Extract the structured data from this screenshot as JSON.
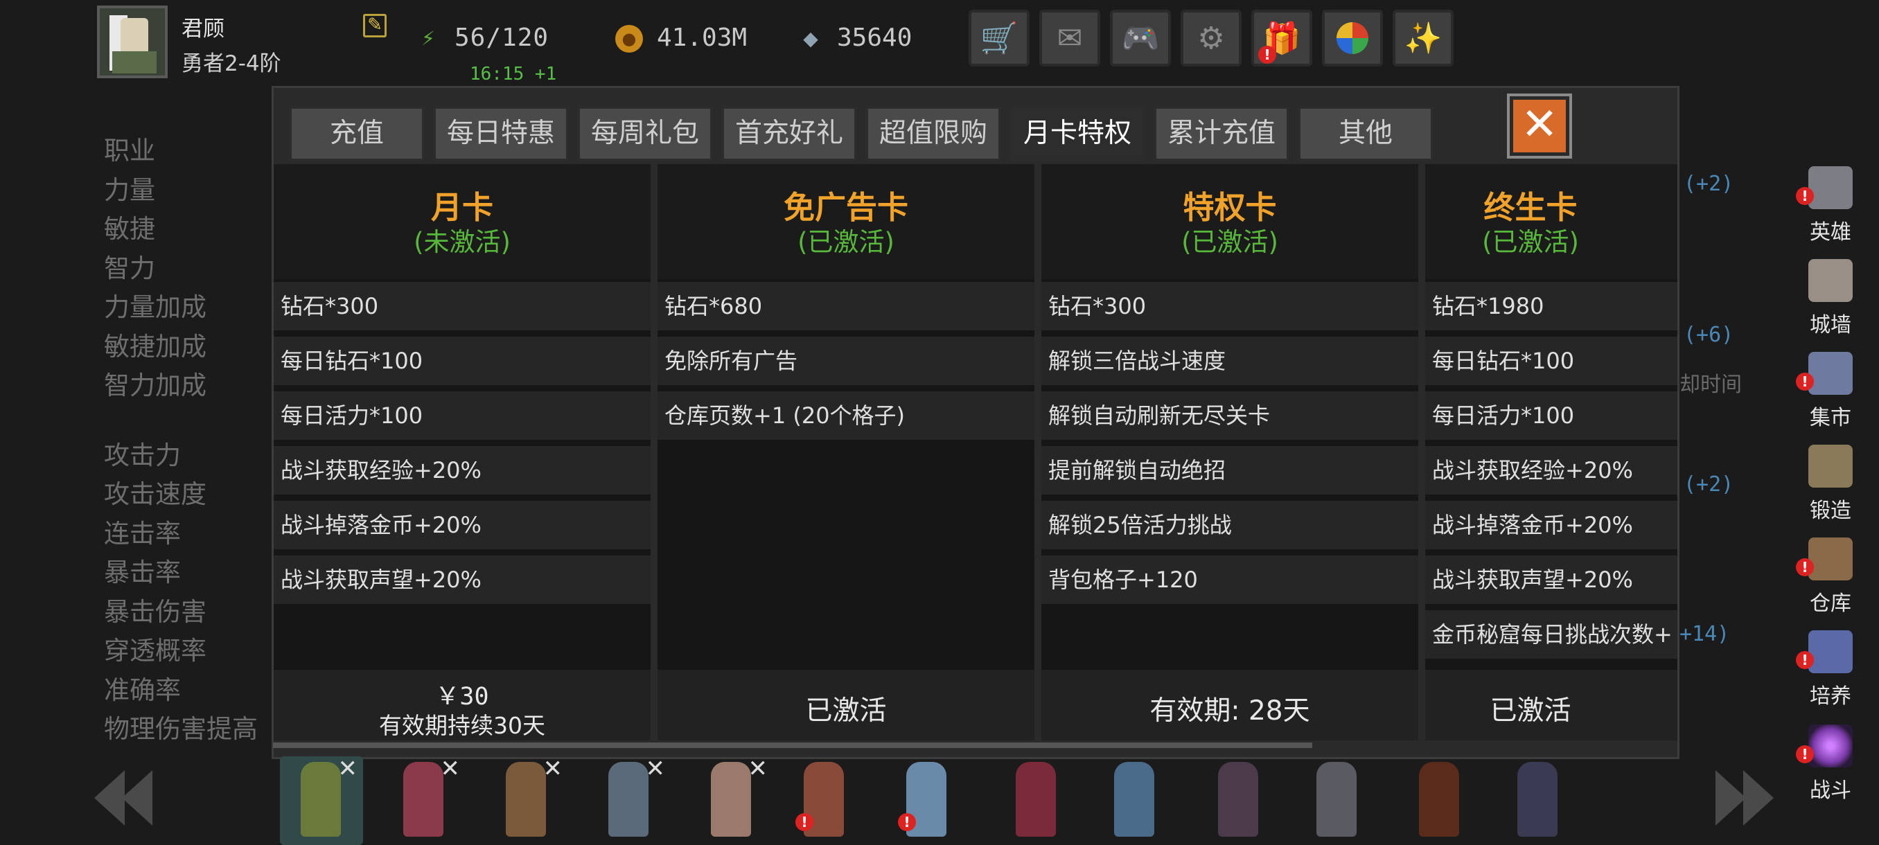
{
  "player": {
    "name": "君顾",
    "rank": "勇者2-4阶"
  },
  "resources": {
    "energy": "56/120",
    "energy_timer": "16:15 +1",
    "gold": "41.03M",
    "diamonds": "35640"
  },
  "top_buttons": [
    "shop-cart-icon",
    "mail-icon",
    "gamepad-icon",
    "settings-gear-icon",
    "gift-icon",
    "prize-wheel-icon",
    "fireworks-icon"
  ],
  "stats_left": {
    "group1": [
      "职业",
      "力量",
      "敏捷",
      "智力",
      "力量加成",
      "敏捷加成",
      "智力加成"
    ],
    "group2": [
      "攻击力",
      "攻击速度",
      "连击率",
      "暴击率",
      "暴击伤害",
      "穿透概率",
      "准确率",
      "物理伤害提高"
    ]
  },
  "bg_snippets": [
    "(+2)",
    "(+6)",
    "却时间",
    "(+2)",
    "+14)"
  ],
  "tabs": [
    "充值",
    "每日特惠",
    "每周礼包",
    "首充好礼",
    "超值限购",
    "月卡特权",
    "累计充值",
    "其他"
  ],
  "active_tab": "月卡特权",
  "cards": [
    {
      "title": "月卡",
      "status": "(未激活)",
      "rows": [
        "钻石*300",
        "每日钻石*100",
        "每日活力*100",
        "战斗获取经验+20%",
        "战斗掉落金币+20%",
        "战斗获取声望+20%"
      ],
      "price": "￥30",
      "footer_sub": "有效期持续30天"
    },
    {
      "title": "免广告卡",
      "status": "(已激活)",
      "rows": [
        "钻石*680",
        "免除所有广告",
        "仓库页数+1 (20个格子)"
      ],
      "footer": "已激活"
    },
    {
      "title": "特权卡",
      "status": "(已激活)",
      "rows": [
        "钻石*300",
        "解锁三倍战斗速度",
        "解锁自动刷新无尽关卡",
        "提前解锁自动绝招",
        "解锁25倍活力挑战",
        "背包格子+120"
      ],
      "footer": "有效期: 28天"
    },
    {
      "title": "终生卡",
      "status": "(已激活)",
      "rows": [
        "钻石*1980",
        "每日钻石*100",
        "每日活力*100",
        "战斗获取经验+20%",
        "战斗掉落金币+20%",
        "战斗获取声望+20%",
        "金币秘窟每日挑战次数+"
      ],
      "footer": "已激活"
    }
  ],
  "side_nav": [
    {
      "label": "英雄",
      "icon": "hero-helmet-icon",
      "color": "#7d7d86"
    },
    {
      "label": "城墙",
      "icon": "castle-wall-icon",
      "color": "#9a8f86"
    },
    {
      "label": "集市",
      "icon": "market-icon",
      "color": "#6f7aa0"
    },
    {
      "label": "锻造",
      "icon": "anvil-icon",
      "color": "#8a7a5a"
    },
    {
      "label": "仓库",
      "icon": "warehouse-chest-icon",
      "color": "#8a6a48"
    },
    {
      "label": "培养",
      "icon": "trophy-cup-icon",
      "color": "#5a6aa8"
    },
    {
      "label": "战斗",
      "icon": "portal-swirl-icon",
      "color": "#7a3aa8"
    }
  ],
  "heroes": [
    {
      "name": "archer-hero",
      "color": "#6a7a3a",
      "equipped": true
    },
    {
      "name": "red-mage-hero",
      "color": "#8a3a4a",
      "equipped": true
    },
    {
      "name": "barbarian-hero",
      "color": "#7a5a3a",
      "equipped": true
    },
    {
      "name": "knight-hero",
      "color": "#5a6a7a",
      "equipped": true
    },
    {
      "name": "dancer-hero",
      "color": "#9a7a6a",
      "equipped": true
    },
    {
      "name": "gunner-hero",
      "color": "#8a4a3a",
      "alert": true
    },
    {
      "name": "ice-mage-hero",
      "color": "#6a8aaa",
      "alert": true
    },
    {
      "name": "red-lady-hero",
      "color": "#7a2a3a"
    },
    {
      "name": "frost-elf-hero",
      "color": "#4a6a8a"
    },
    {
      "name": "dark-priest-hero",
      "color": "#4a3a4a"
    },
    {
      "name": "swordsman-hero",
      "color": "#5a5a62"
    },
    {
      "name": "demon-hero",
      "color": "#5a2a1a"
    },
    {
      "name": "shadow-hero",
      "color": "#3a3a52"
    }
  ],
  "colors": {
    "title_orange": "#f1a22b",
    "status_green": "#58b83c",
    "close_orange": "#d86a2a",
    "badge_red": "#dd2222"
  }
}
